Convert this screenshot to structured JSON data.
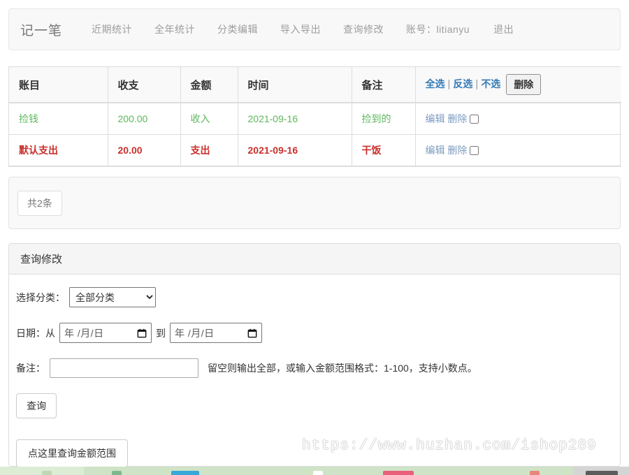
{
  "navbar": {
    "brand": "记一笔",
    "items": [
      {
        "label": "近期统计",
        "name": "nav-recent-stats"
      },
      {
        "label": "全年统计",
        "name": "nav-yearly-stats"
      },
      {
        "label": "分类编辑",
        "name": "nav-category-edit"
      },
      {
        "label": "导入导出",
        "name": "nav-import-export"
      },
      {
        "label": "查询修改",
        "name": "nav-query-edit"
      }
    ],
    "account": "账号：litianyu",
    "logout": "退出"
  },
  "table": {
    "headers": {
      "name": "账目",
      "type": "收支",
      "amount": "金额",
      "date": "时间",
      "note": "备注"
    },
    "header_ops": {
      "select_all": "全选",
      "invert": "反选",
      "select_none": "不选",
      "separator": "|",
      "delete_button": "删除"
    },
    "row_ops": {
      "edit": "编辑",
      "delete": "删除"
    },
    "rows": [
      {
        "name": "捡钱",
        "amount": "200.00",
        "type": "收入",
        "date": "2021-09-16",
        "note": "捡到的",
        "kind": "income",
        "checked": false
      },
      {
        "name": "默认支出",
        "amount": "20.00",
        "type": "支出",
        "date": "2021-09-16",
        "note": "干饭",
        "kind": "expense",
        "checked": false
      }
    ]
  },
  "count_panel": {
    "total_label": "共2条"
  },
  "query_panel": {
    "title": "查询修改",
    "category_label": "选择分类：",
    "category_selected": "全部分类",
    "category_options": [
      "全部分类"
    ],
    "date_label": "日期：从",
    "date_from_placeholder": "年 /月/日",
    "date_from_value": "",
    "date_to_separator": "到",
    "date_to_placeholder": "年 /月/日",
    "date_to_value": "",
    "note_label": "备注：",
    "note_value": "",
    "note_placeholder": "",
    "note_hint": "留空则输出全部，或输入金额范围格式：1-100，支持小数点。",
    "query_button": "查询",
    "range_button": "点这里查询金额范围"
  },
  "watermark": {
    "text": "https://www.huzhan.com/ishop289"
  },
  "colors": {
    "income": "#5cb85c",
    "expense": "#c9302c",
    "link": "#337ab7",
    "row_link": "#7b9cc0",
    "nav_text": "#9d9d9d",
    "panel_bg": "#f9f9f9",
    "border": "#dddddd",
    "taskbar": "#d7e8cf"
  }
}
